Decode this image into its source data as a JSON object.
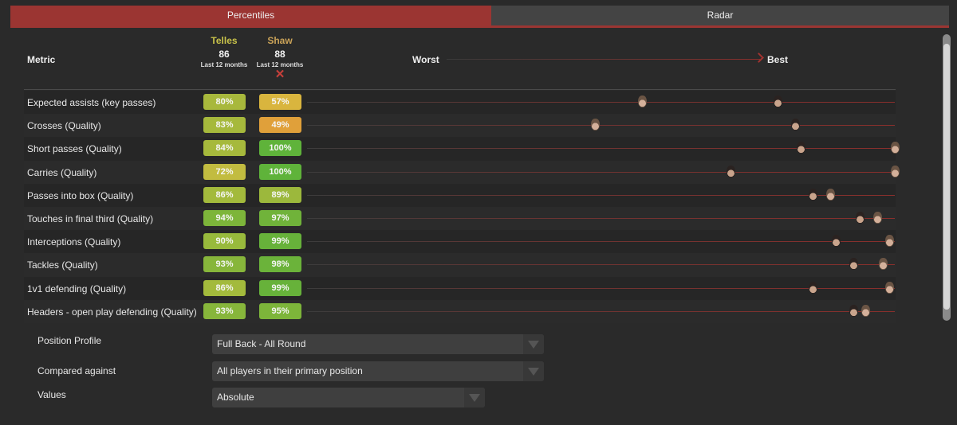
{
  "tabs": [
    {
      "label": "Percentiles",
      "active": true
    },
    {
      "label": "Radar",
      "active": false
    }
  ],
  "header": {
    "metric_label": "Metric",
    "worst_label": "Worst",
    "best_label": "Best"
  },
  "players": [
    {
      "name": "Telles",
      "score": "86",
      "period": "Last 12 months",
      "color": "#c8c24a",
      "removable": false
    },
    {
      "name": "Shaw",
      "score": "88",
      "period": "Last 12 months",
      "color": "#c9a258",
      "removable": true,
      "remove_icon": "✕"
    }
  ],
  "metrics": [
    {
      "name": "Expected assists (key passes)",
      "values": [
        80,
        57
      ],
      "labels": [
        "80%",
        "57%"
      ],
      "colors": [
        "#a8b83c",
        "#d9b53e"
      ]
    },
    {
      "name": "Crosses (Quality)",
      "values": [
        83,
        49
      ],
      "labels": [
        "83%",
        "49%"
      ],
      "colors": [
        "#a6b93c",
        "#e0a03a"
      ]
    },
    {
      "name": "Short passes (Quality)",
      "values": [
        84,
        100
      ],
      "labels": [
        "84%",
        "100%"
      ],
      "colors": [
        "#a6b93c",
        "#5fb33a"
      ]
    },
    {
      "name": "Carries (Quality)",
      "values": [
        72,
        100
      ],
      "labels": [
        "72%",
        "100%"
      ],
      "colors": [
        "#c2bc40",
        "#5fb33a"
      ]
    },
    {
      "name": "Passes into box (Quality)",
      "values": [
        86,
        89
      ],
      "labels": [
        "86%",
        "89%"
      ],
      "colors": [
        "#a3ba3c",
        "#9cb83c"
      ]
    },
    {
      "name": "Touches in final third (Quality)",
      "values": [
        94,
        97
      ],
      "labels": [
        "94%",
        "97%"
      ],
      "colors": [
        "#7db53a",
        "#70b33a"
      ]
    },
    {
      "name": "Interceptions (Quality)",
      "values": [
        90,
        99
      ],
      "labels": [
        "90%",
        "99%"
      ],
      "colors": [
        "#98ba3c",
        "#67b23a"
      ]
    },
    {
      "name": "Tackles (Quality)",
      "values": [
        93,
        98
      ],
      "labels": [
        "93%",
        "98%"
      ],
      "colors": [
        "#87b63b",
        "#6bb33a"
      ]
    },
    {
      "name": "1v1 defending (Quality)",
      "values": [
        86,
        99
      ],
      "labels": [
        "86%",
        "99%"
      ],
      "colors": [
        "#a3ba3c",
        "#67b23a"
      ]
    },
    {
      "name": "Headers - open play defending (Quality)",
      "values": [
        93,
        95
      ],
      "labels": [
        "93%",
        "95%"
      ],
      "colors": [
        "#87b63b",
        "#7db53a"
      ]
    }
  ],
  "controls": [
    {
      "label": "Position Profile",
      "value": "Full Back - All Round"
    },
    {
      "label": "Compared against",
      "value": "All players in their primary position"
    },
    {
      "label": "Values",
      "value": "Absolute"
    }
  ],
  "colors": {
    "accent": "#9b3532",
    "background": "#2a2a2a"
  }
}
